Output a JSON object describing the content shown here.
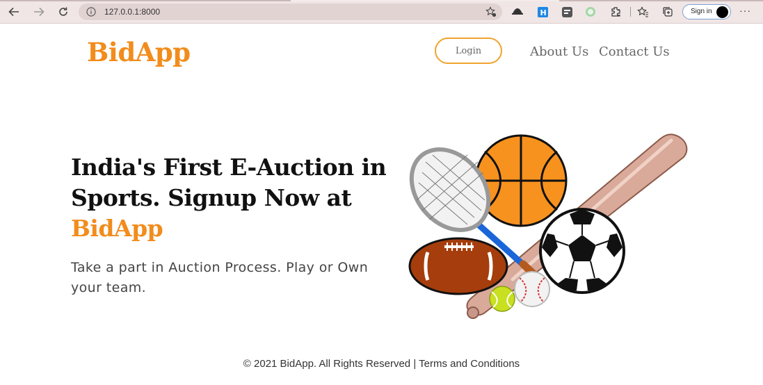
{
  "browser": {
    "url": "127.0.0.1:8000",
    "sign_in_label": "Sign in",
    "icons": [
      "back-arrow-icon",
      "forward-arrow-icon",
      "refresh-icon",
      "info-icon",
      "favorite-star-icon",
      "extension-icon",
      "collections-icon",
      "profile-avatar-icon",
      "more-icon"
    ]
  },
  "header": {
    "logo": "BidApp",
    "login_label": "Login",
    "nav": [
      {
        "label": "About Us"
      },
      {
        "label": "Contact Us"
      }
    ]
  },
  "hero": {
    "title_line1": "India's First E-Auction in",
    "title_line2": "Sports. Signup Now at",
    "title_accent": "BidApp",
    "subtitle": "Take a part in Auction Process. Play or Own your team."
  },
  "footer": {
    "text": "© 2021 BidApp. All Rights Reserved | Terms and Conditions"
  },
  "colors": {
    "accent": "#f28c1c",
    "login_border": "#f0a32e"
  }
}
